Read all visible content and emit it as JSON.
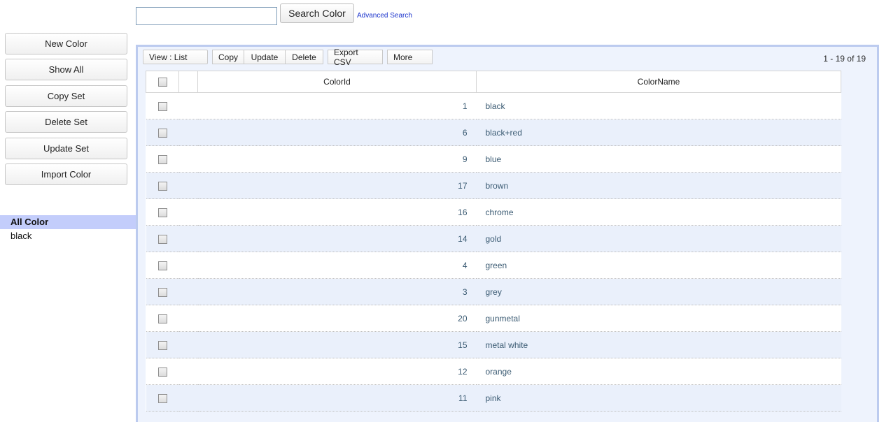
{
  "search": {
    "input_value": "",
    "button_label": "Search Color",
    "advanced_link": "Advanced Search"
  },
  "sidebar": {
    "buttons": [
      {
        "label": "New Color"
      },
      {
        "label": "Show All"
      },
      {
        "label": "Copy Set"
      },
      {
        "label": "Delete Set"
      },
      {
        "label": "Update Set"
      },
      {
        "label": "Import Color"
      }
    ],
    "lists": [
      {
        "label": "All Color",
        "active": true
      },
      {
        "label": "black",
        "active": false
      }
    ]
  },
  "toolbar": {
    "view_label": "View : List",
    "copy_label": "Copy",
    "update_label": "Update",
    "delete_label": "Delete",
    "export_label": "Export CSV",
    "more_label": "More"
  },
  "pager": {
    "text": "1 - 19 of 19"
  },
  "table": {
    "columns": [
      "ColorId",
      "ColorName"
    ],
    "rows": [
      {
        "id": "1",
        "name": "black"
      },
      {
        "id": "6",
        "name": "black+red"
      },
      {
        "id": "9",
        "name": "blue"
      },
      {
        "id": "17",
        "name": "brown"
      },
      {
        "id": "16",
        "name": "chrome"
      },
      {
        "id": "14",
        "name": "gold"
      },
      {
        "id": "4",
        "name": "green"
      },
      {
        "id": "3",
        "name": "grey"
      },
      {
        "id": "20",
        "name": "gunmetal"
      },
      {
        "id": "15",
        "name": "metal white"
      },
      {
        "id": "12",
        "name": "orange"
      },
      {
        "id": "11",
        "name": "pink"
      }
    ]
  },
  "colors": {
    "panel_border": "#bccbef",
    "row_alt": "#eaf0fb",
    "active_list": "#c3cdfb",
    "link": "#1a33cc"
  }
}
